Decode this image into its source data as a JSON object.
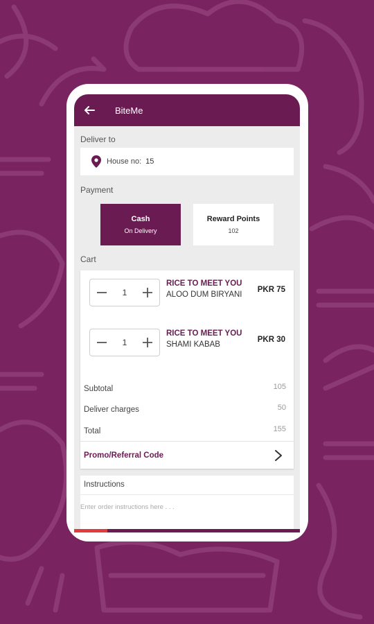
{
  "appbar": {
    "title": "BiteMe"
  },
  "deliver": {
    "label": "Deliver to",
    "address_label": "House no:",
    "address_value": "15"
  },
  "payment": {
    "label": "Payment",
    "cash_title": "Cash",
    "cash_sub": "On Delivery",
    "reward_title": "Reward Points",
    "reward_sub": "102"
  },
  "cart": {
    "label": "Cart",
    "items": [
      {
        "restaurant": "RICE TO MEET YOU",
        "name": "ALOO DUM BIRYANI",
        "price": "PKR 75",
        "qty": "1"
      },
      {
        "restaurant": "RICE TO MEET YOU",
        "name": "SHAMI KABAB",
        "price": "PKR 30",
        "qty": "1"
      }
    ],
    "subtotal_label": "Subtotal",
    "subtotal": "105",
    "delivery_label": "Deliver charges",
    "delivery": "50",
    "total_label": "Total",
    "total": "155",
    "promo_label": "Promo/Referral Code"
  },
  "instructions": {
    "label": "Instructions",
    "placeholder": "Enter order instructions here . . ."
  },
  "colors": {
    "brand": "#6a1c52",
    "background": "#7a2361",
    "accent_red": "#e23b3b"
  }
}
